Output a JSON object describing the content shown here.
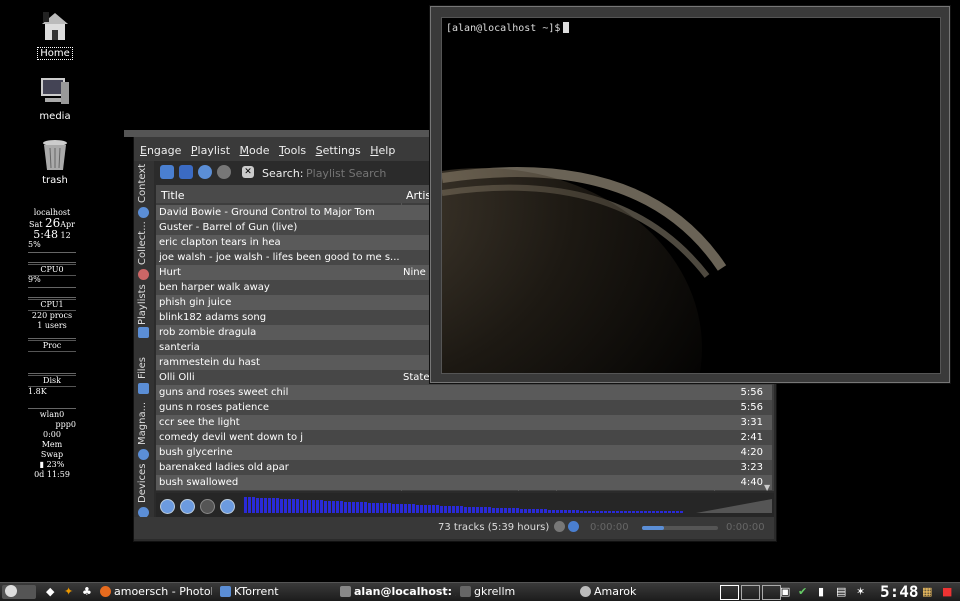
{
  "desktop": {
    "icons": [
      {
        "label": "Home",
        "icon": "home-icon"
      },
      {
        "label": "media",
        "icon": "computer-icon"
      },
      {
        "label": "trash",
        "icon": "trash-icon"
      }
    ]
  },
  "gkrellm": {
    "hostname": "localhost",
    "day": "Sat",
    "date": "26",
    "month": "Apr",
    "time": "5:48",
    "seconds": "12",
    "cpu_total": "5%",
    "cpu0_label": "CPU0",
    "cpu0": "9%",
    "cpu1_label": "CPU1",
    "procs": "220 procs",
    "users": "1 users",
    "proc_label": "Proc",
    "disk_label": "Disk",
    "disk_value": "1.8K",
    "net_iface1": "wlan0",
    "net_iface2": "ppp0",
    "ppp_time": "0:00",
    "mem_label": "Mem",
    "swap_label": "Swap",
    "battery": "23%",
    "uptime": "0d 11:59"
  },
  "amarok": {
    "menu": [
      "Engage",
      "Playlist",
      "Mode",
      "Tools",
      "Settings",
      "Help"
    ],
    "side_tabs": [
      "Context",
      "Collect...",
      "Playlists",
      "Files",
      "Magna...",
      "Devices"
    ],
    "search_label": "Search:",
    "search_placeholder": "Playlist Search",
    "columns": {
      "title": "Title",
      "artist": "Artist"
    },
    "tracks": [
      {
        "title": "David Bowie - Ground Control to Major Tom",
        "artist": "",
        "length": ""
      },
      {
        "title": "Guster - Barrel of Gun (live)",
        "artist": "",
        "length": ""
      },
      {
        "title": "eric clapton   tears in hea",
        "artist": "",
        "length": ""
      },
      {
        "title": "joe walsh - joe walsh - lifes been good to me s...",
        "artist": "",
        "length": ""
      },
      {
        "title": "Hurt",
        "artist": "Nine",
        "length": ""
      },
      {
        "title": "ben harper   walk away",
        "artist": "",
        "length": ""
      },
      {
        "title": "phish   gin   juice",
        "artist": "",
        "length": ""
      },
      {
        "title": "blink182  adams song",
        "artist": "",
        "length": ""
      },
      {
        "title": "rob zombie   dragula",
        "artist": "",
        "length": ""
      },
      {
        "title": "santeria",
        "artist": "",
        "length": ""
      },
      {
        "title": "rammestein  du hast",
        "artist": "",
        "length": ""
      },
      {
        "title": "Olli Olli",
        "artist": "State",
        "length": ""
      },
      {
        "title": "guns and roses   sweet chil",
        "artist": "",
        "length": "5:56"
      },
      {
        "title": "guns n roses   patience",
        "artist": "",
        "length": "5:56"
      },
      {
        "title": "ccr   see the light",
        "artist": "",
        "length": "3:31"
      },
      {
        "title": "comedy devil went down to j",
        "artist": "",
        "length": "2:41"
      },
      {
        "title": "bush   glycerine",
        "artist": "",
        "length": "4:20"
      },
      {
        "title": "barenaked ladies   old apar",
        "artist": "",
        "length": "3:23"
      },
      {
        "title": "bush   swallowed",
        "artist": "",
        "length": "4:40"
      }
    ],
    "status": "73 tracks (5:39 hours)",
    "time_elapsed": "0:00:00",
    "time_remaining": "0:00:00"
  },
  "terminal": {
    "prompt": "[alan@localhost ~]$"
  },
  "taskbar": {
    "tasks": [
      {
        "label": "amoersch - Photobu",
        "icon": "firefox-icon"
      },
      {
        "label": "KTorrent",
        "icon": "ktorrent-icon"
      },
      {
        "label": "alan@localhost: /h",
        "icon": "terminal-icon"
      },
      {
        "label": "gkrellm",
        "icon": "gkrellm-icon"
      },
      {
        "label": "Amarok",
        "icon": "amarok-icon"
      }
    ],
    "clock": "5:48"
  },
  "colors": {
    "accent": "#5b8ed6",
    "row_alt": "#5a5a5a",
    "row": "#474747",
    "visual_bar": "#2a2ad8"
  }
}
